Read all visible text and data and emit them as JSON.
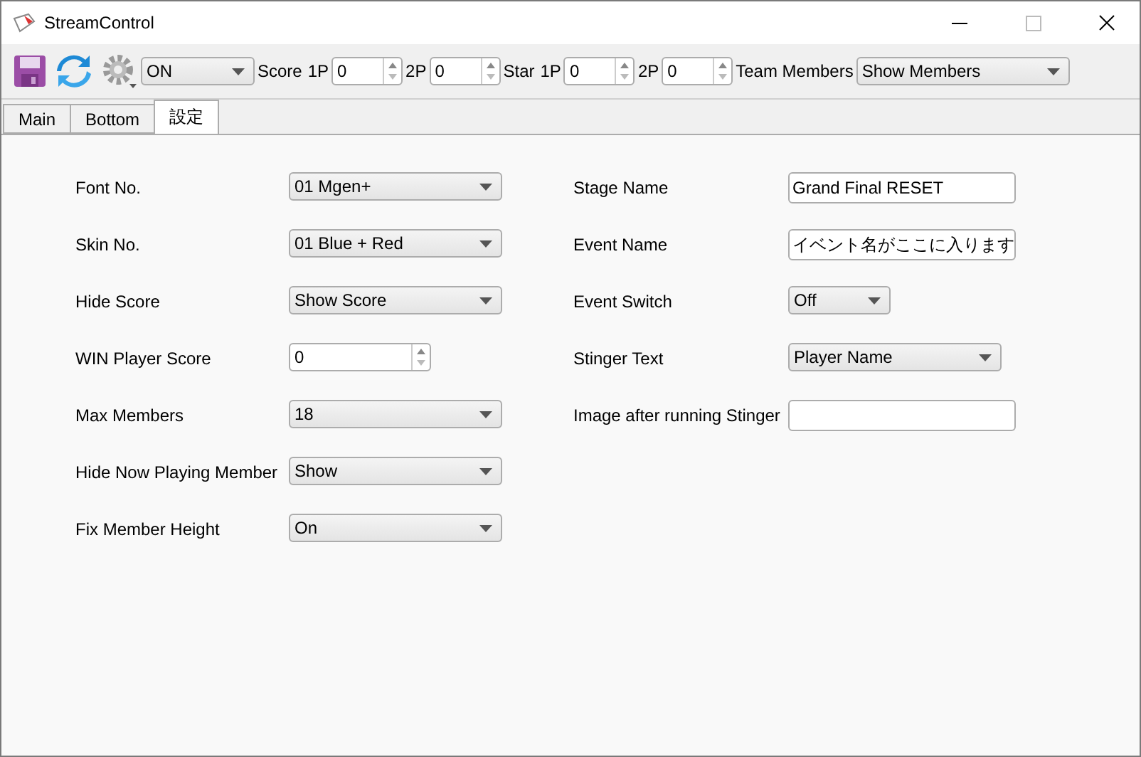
{
  "window": {
    "title": "StreamControl"
  },
  "toolbar": {
    "mode_select": {
      "value": "ON"
    },
    "groups": [
      {
        "label": "Score",
        "spins": [
          {
            "label": "1P",
            "value": "0"
          },
          {
            "label": "2P",
            "value": "0"
          }
        ]
      },
      {
        "label": "Star",
        "spins": [
          {
            "label": "1P",
            "value": "0"
          },
          {
            "label": "2P",
            "value": "0"
          }
        ]
      }
    ],
    "team_members": {
      "label": "Team Members",
      "value": "Show Members"
    }
  },
  "tabs": [
    {
      "label": "Main",
      "selected": false
    },
    {
      "label": "Bottom",
      "selected": false
    },
    {
      "label": "設定",
      "selected": true
    }
  ],
  "left_fields": [
    {
      "label": "Font No.",
      "kind": "select",
      "value": "01 Mgen+"
    },
    {
      "label": "Skin No.",
      "kind": "select",
      "value": "01 Blue + Red"
    },
    {
      "label": "Hide Score",
      "kind": "select",
      "value": "Show Score"
    },
    {
      "label": "WIN Player Score",
      "kind": "spin",
      "value": "0"
    },
    {
      "label": "Max Members",
      "kind": "select",
      "value": "18"
    },
    {
      "label": "Hide Now Playing Member",
      "kind": "select",
      "value": "Show"
    },
    {
      "label": "Fix Member Height",
      "kind": "select",
      "value": "On"
    }
  ],
  "right_fields": [
    {
      "label": "Stage Name",
      "kind": "text",
      "value": "Grand Final RESET"
    },
    {
      "label": "Event Name",
      "kind": "text",
      "value": "イベント名がここに入ります"
    },
    {
      "label": "Event Switch",
      "kind": "small_select",
      "value": "Off"
    },
    {
      "label": "Stinger Text",
      "kind": "select",
      "value": "Player Name"
    },
    {
      "label": "Image after running Stinger",
      "kind": "text"
    }
  ]
}
